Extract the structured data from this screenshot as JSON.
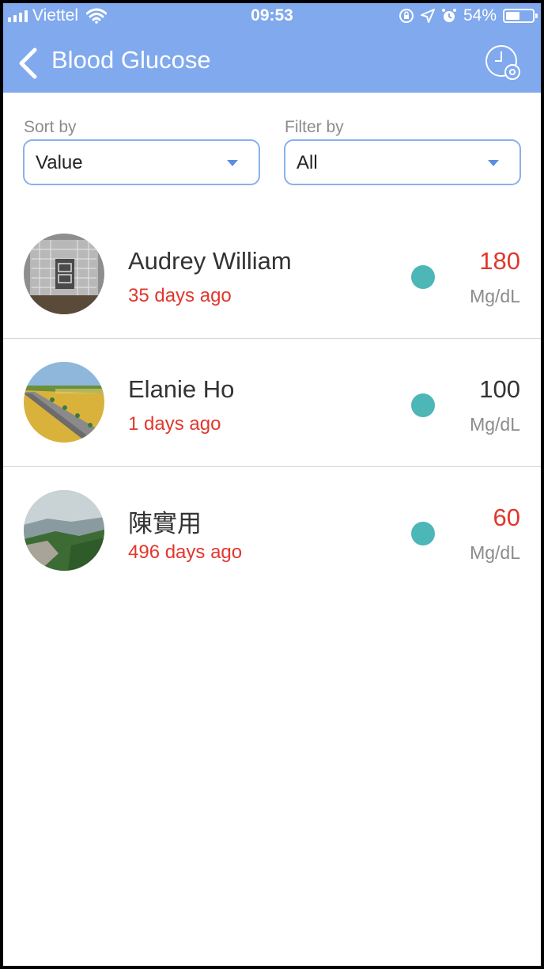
{
  "status_bar": {
    "carrier": "Viettel",
    "time": "09:53",
    "battery": "54%",
    "battery_level": 0.54
  },
  "header": {
    "title": "Blood Glucose",
    "back_icon": "chevron-left-icon",
    "history_icon": "clock-settings-icon",
    "background": "#80a9ee"
  },
  "filters": {
    "sort_label": "Sort by",
    "sort_value": "Value",
    "filter_label": "Filter by",
    "filter_value": "All"
  },
  "patients": [
    {
      "name": "Audrey William",
      "ago": "35 days ago",
      "value": "180",
      "unit": "Mg/dL",
      "value_color": "#e2372d",
      "status_color": "#4db6b6"
    },
    {
      "name": "Elanie Ho",
      "ago": "1 days ago",
      "value": "100",
      "unit": "Mg/dL",
      "value_color": "#333333",
      "status_color": "#4db6b6"
    },
    {
      "name": "陳實用",
      "ago": "496 days ago",
      "value": "60",
      "unit": "Mg/dL",
      "value_color": "#e2372d",
      "status_color": "#4db6b6"
    }
  ]
}
